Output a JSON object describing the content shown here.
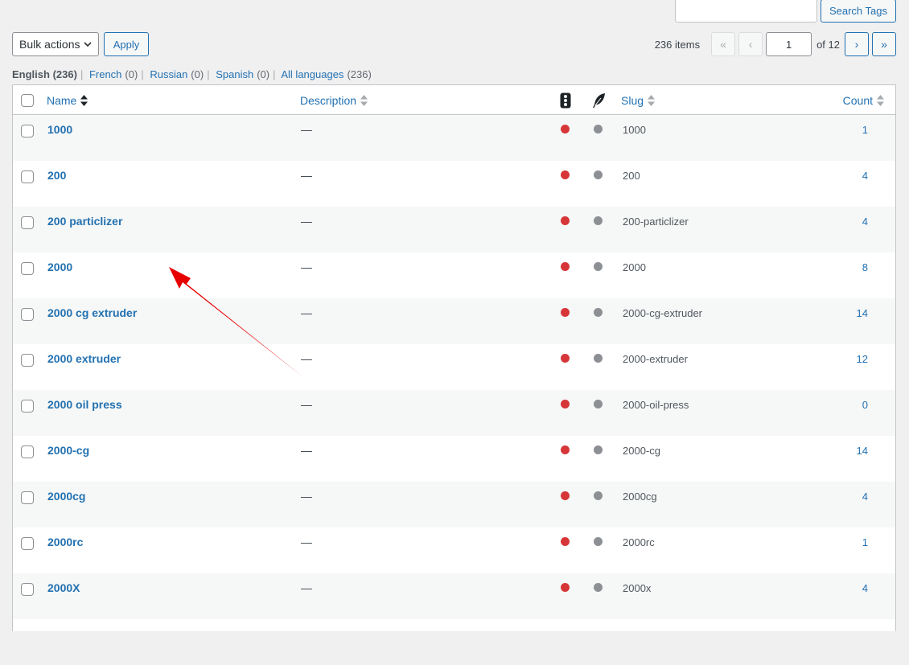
{
  "search": {
    "placeholder": "",
    "button_label": "Search Tags"
  },
  "bulk": {
    "selected": "Bulk actions",
    "apply_label": "Apply"
  },
  "pagination": {
    "items": "236 items",
    "first": "«",
    "prev": "‹",
    "current_page": "1",
    "of_pages": "of 12",
    "next": "›",
    "last": "»"
  },
  "languages": [
    {
      "label": "English",
      "count": "(236)",
      "current": true
    },
    {
      "label": "French",
      "count": "(0)",
      "current": false
    },
    {
      "label": "Russian",
      "count": "(0)",
      "current": false
    },
    {
      "label": "Spanish",
      "count": "(0)",
      "current": false
    },
    {
      "label": "All languages",
      "count": "(236)",
      "current": false
    }
  ],
  "columns": {
    "name": "Name",
    "description": "Description",
    "slug": "Slug",
    "count": "Count"
  },
  "colors": {
    "accent": "#2271b1",
    "red_dot": "#d63638",
    "gray_dot": "#8c8f94",
    "arrow": "#e60000"
  },
  "rows": [
    {
      "name": "1000",
      "description": "—",
      "slug": "1000",
      "count": "1"
    },
    {
      "name": "200",
      "description": "—",
      "slug": "200",
      "count": "4"
    },
    {
      "name": "200 particlizer",
      "description": "—",
      "slug": "200-particlizer",
      "count": "4"
    },
    {
      "name": "2000",
      "description": "—",
      "slug": "2000",
      "count": "8"
    },
    {
      "name": "2000 cg extruder",
      "description": "—",
      "slug": "2000-cg-extruder",
      "count": "14"
    },
    {
      "name": "2000 extruder",
      "description": "—",
      "slug": "2000-extruder",
      "count": "12"
    },
    {
      "name": "2000 oil press",
      "description": "—",
      "slug": "2000-oil-press",
      "count": "0"
    },
    {
      "name": "2000-cg",
      "description": "—",
      "slug": "2000-cg",
      "count": "14"
    },
    {
      "name": "2000cg",
      "description": "—",
      "slug": "2000cg",
      "count": "4"
    },
    {
      "name": "2000rc",
      "description": "—",
      "slug": "2000rc",
      "count": "1"
    },
    {
      "name": "2000X",
      "description": "—",
      "slug": "2000x",
      "count": "4"
    },
    {
      "name": "",
      "description": "",
      "slug": "",
      "count": ""
    }
  ]
}
